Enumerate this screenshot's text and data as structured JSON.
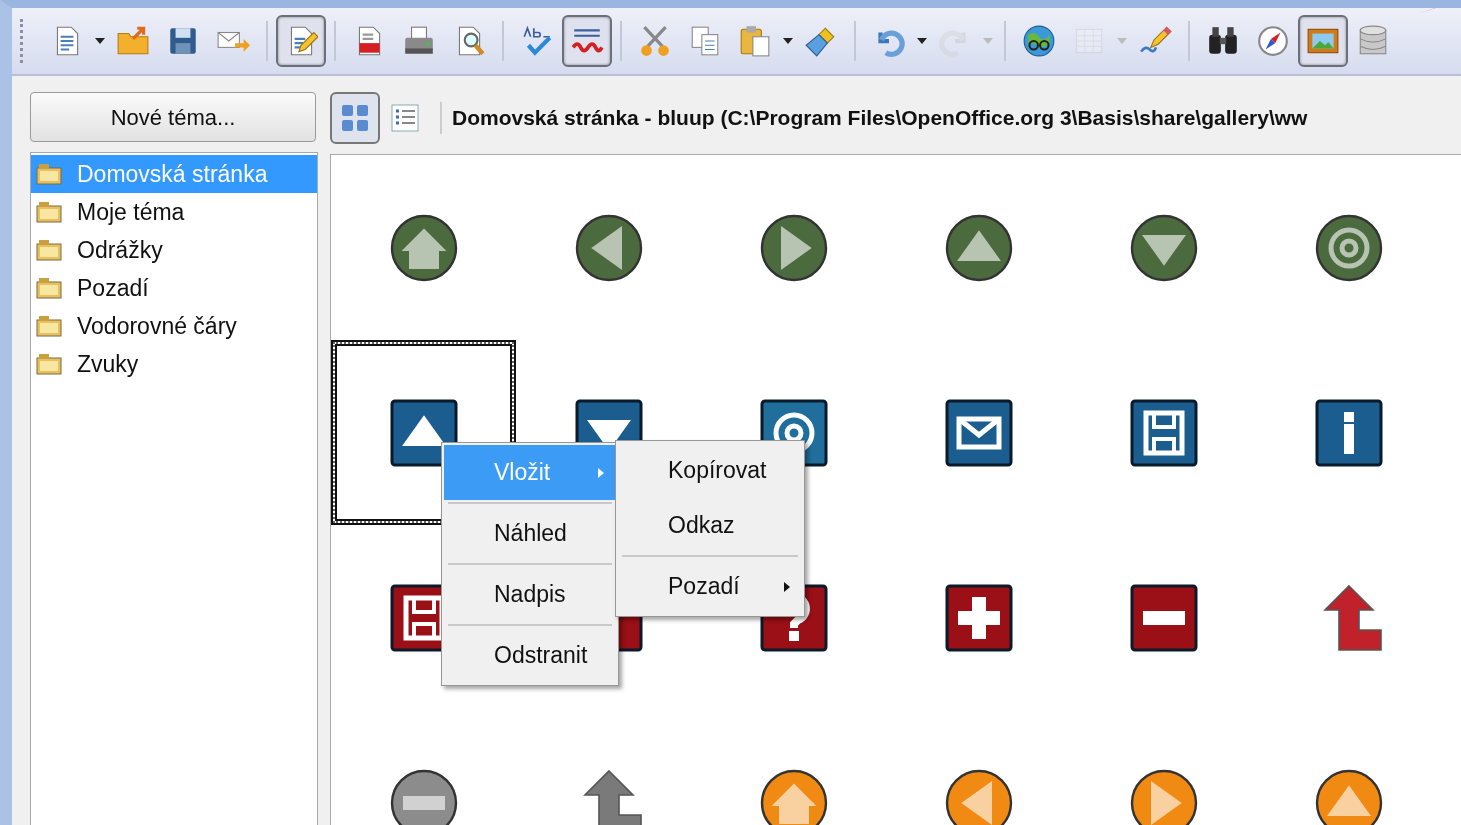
{
  "toolbar": [
    {
      "kind": "button",
      "pressed": false,
      "disabled": false,
      "dropdown": true
    },
    {
      "kind": "button",
      "pressed": false,
      "disabled": false,
      "dropdown": false
    },
    {
      "kind": "button",
      "pressed": false,
      "disabled": false,
      "dropdown": false
    },
    {
      "kind": "button",
      "pressed": false,
      "disabled": false,
      "dropdown": false
    },
    {
      "kind": "separator"
    },
    {
      "kind": "button",
      "pressed": true,
      "disabled": false,
      "dropdown": false
    },
    {
      "kind": "separator"
    },
    {
      "kind": "button",
      "pressed": false,
      "disabled": false,
      "dropdown": false
    },
    {
      "kind": "button",
      "pressed": false,
      "disabled": false,
      "dropdown": false
    },
    {
      "kind": "button",
      "pressed": false,
      "disabled": false,
      "dropdown": false
    },
    {
      "kind": "separator"
    },
    {
      "kind": "button",
      "pressed": false,
      "disabled": false,
      "dropdown": false
    },
    {
      "kind": "button",
      "pressed": true,
      "disabled": false,
      "dropdown": false
    },
    {
      "kind": "separator"
    },
    {
      "kind": "button",
      "pressed": false,
      "disabled": false,
      "dropdown": false
    },
    {
      "kind": "button",
      "pressed": false,
      "disabled": false,
      "dropdown": false
    },
    {
      "kind": "button",
      "pressed": false,
      "disabled": false,
      "dropdown": true
    },
    {
      "kind": "button",
      "pressed": false,
      "disabled": false,
      "dropdown": false
    },
    {
      "kind": "separator"
    },
    {
      "kind": "button",
      "pressed": false,
      "disabled": false,
      "dropdown": true
    },
    {
      "kind": "button",
      "pressed": false,
      "disabled": true,
      "dropdown": true
    },
    {
      "kind": "separator"
    },
    {
      "kind": "button",
      "pressed": false,
      "disabled": false,
      "dropdown": false
    },
    {
      "kind": "button",
      "pressed": false,
      "disabled": true,
      "dropdown": true
    },
    {
      "kind": "button",
      "pressed": false,
      "disabled": false,
      "dropdown": false
    },
    {
      "kind": "separator"
    },
    {
      "kind": "button",
      "pressed": false,
      "disabled": false,
      "dropdown": false
    },
    {
      "kind": "button",
      "pressed": false,
      "disabled": false,
      "dropdown": false
    },
    {
      "kind": "button",
      "pressed": true,
      "disabled": false,
      "dropdown": false
    },
    {
      "kind": "button",
      "pressed": false,
      "disabled": false,
      "dropdown": false
    }
  ],
  "sidebar": {
    "new_theme_button": "Nové téma...",
    "themes": [
      {
        "label": "Domovská stránka",
        "selected": true
      },
      {
        "label": "Moje téma",
        "selected": false
      },
      {
        "label": "Odrážky",
        "selected": false
      },
      {
        "label": "Pozadí",
        "selected": false
      },
      {
        "label": "Vodorovné čáry",
        "selected": false
      },
      {
        "label": "Zvuky",
        "selected": false
      }
    ]
  },
  "view_modes": [
    {
      "selected": true
    },
    {
      "selected": false
    }
  ],
  "gallery_title": "Domovská stránka - bluup (C:\\Program Files\\OpenOffice.org 3\\Basis\\share\\gallery\\ww",
  "gallery_items": [
    {
      "kind": "round",
      "color": "#4b6b3f",
      "selected": false
    },
    {
      "kind": "round",
      "color": "#4b6b3f",
      "selected": false
    },
    {
      "kind": "round",
      "color": "#4b6b3f",
      "selected": false
    },
    {
      "kind": "round",
      "color": "#4b6b3f",
      "selected": false
    },
    {
      "kind": "round",
      "color": "#4b6b3f",
      "selected": false
    },
    {
      "kind": "round",
      "color": "#4b6b3f",
      "selected": false
    },
    {
      "kind": "tile",
      "color": "#1a5d8e",
      "selected": true
    },
    {
      "kind": "tile",
      "color": "#1a5d8e",
      "selected": false
    },
    {
      "kind": "tile",
      "color": "#1f6e9c",
      "selected": false
    },
    {
      "kind": "tile",
      "color": "#1a5d8e",
      "selected": false
    },
    {
      "kind": "tile",
      "color": "#1a5d8e",
      "selected": false
    },
    {
      "kind": "tile",
      "color": "#1a5d8e",
      "selected": false
    },
    {
      "kind": "tile",
      "color": "#9a1016",
      "selected": false
    },
    {
      "kind": "tile",
      "color": "#9a1016",
      "selected": false
    },
    {
      "kind": "tile",
      "color": "#9a1016",
      "selected": false
    },
    {
      "kind": "tile",
      "color": "#9a1016",
      "selected": false
    },
    {
      "kind": "tile",
      "color": "#9a1016",
      "selected": false
    },
    {
      "kind": "arrow",
      "color": "#c0212a",
      "selected": false
    },
    {
      "kind": "round",
      "color": "#8c8c8c",
      "selected": false
    },
    {
      "kind": "arrow",
      "color": "#7a7a7a",
      "selected": false
    },
    {
      "kind": "round",
      "color": "#f08a12",
      "selected": false
    },
    {
      "kind": "round",
      "color": "#f08a12",
      "selected": false
    },
    {
      "kind": "round",
      "color": "#f08a12",
      "selected": false
    },
    {
      "kind": "round",
      "color": "#f08a12",
      "selected": false
    }
  ],
  "context_menu": {
    "items": [
      {
        "kind": "item",
        "label": "Vložit",
        "selected": true,
        "submenu": true
      },
      {
        "kind": "separator"
      },
      {
        "kind": "item",
        "label": "Náhled",
        "selected": false,
        "submenu": false
      },
      {
        "kind": "separator"
      },
      {
        "kind": "item",
        "label": "Nadpis",
        "selected": false,
        "submenu": false
      },
      {
        "kind": "separator"
      },
      {
        "kind": "item",
        "label": "Odstranit",
        "selected": false,
        "submenu": false
      }
    ]
  },
  "submenu": {
    "items": [
      {
        "kind": "item",
        "label": "Kopírovat",
        "selected": false,
        "submenu": false
      },
      {
        "kind": "item",
        "label": "Odkaz",
        "selected": false,
        "submenu": false
      },
      {
        "kind": "separator"
      },
      {
        "kind": "item",
        "label": "Pozadí",
        "selected": false,
        "submenu": true
      }
    ]
  }
}
